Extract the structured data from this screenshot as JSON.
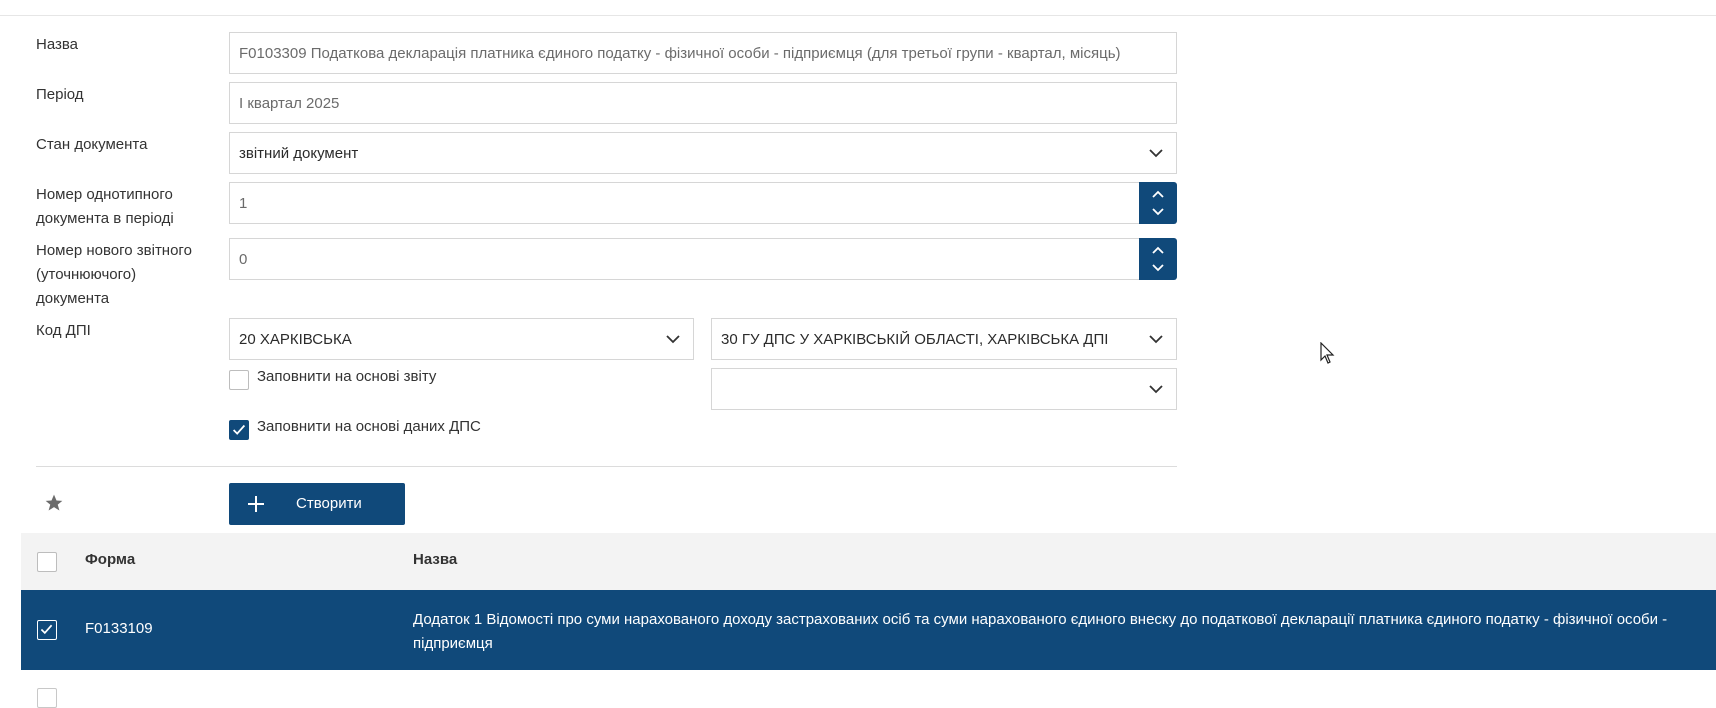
{
  "form": {
    "name_label": "Назва",
    "name_value": "F0103309 Податкова декларація платника єдиного податку - фізичної особи - підприємця (для третьої групи - квартал, місяць)",
    "period_label": "Період",
    "period_value": "І квартал 2025",
    "doc_state_label": "Стан документа",
    "doc_state_value": "звітний документ",
    "same_type_label_line1": "Номер однотипного",
    "same_type_label_line2": "документа в періоді",
    "same_type_value": "1",
    "new_report_label_line1": "Номер нового звітного",
    "new_report_label_line2": "(уточнюючого)",
    "new_report_label_line3": "документа",
    "new_report_value": "0",
    "dpi_label": "Код ДПІ",
    "dpi_region_value": "20 ХАРКІВСЬКА",
    "dpi_office_value": "30 ГУ ДПС У ХАРКІВСЬКІЙ ОБЛАСТІ, ХАРКІВСЬКА ДПІ",
    "dpi_extra_value": "",
    "fill_from_report_label": "Заповнити на основі звіту",
    "fill_from_report_checked": false,
    "fill_from_dps_label": "Заповнити на основі даних ДПС",
    "fill_from_dps_checked": true
  },
  "toolbar": {
    "create_label": "Створити"
  },
  "table": {
    "columns": [
      "Форма",
      "Назва"
    ],
    "rows": [
      {
        "form": "F0133109",
        "name": "Додаток 1 Відомості про суми нарахованого доходу застрахованих осіб та суми нарахованого єдиного внеску до податкової декларації платника єдиного податку - фізичної особи - підприємця",
        "selected": true
      }
    ]
  },
  "colors": {
    "accent": "#10497a",
    "border": "#d6d6d6",
    "header_bg": "#f3f3f3"
  },
  "icons": [
    "chevron-down-icon",
    "chevron-up-icon",
    "check-icon",
    "plus-icon",
    "star-icon",
    "cursor-icon"
  ]
}
